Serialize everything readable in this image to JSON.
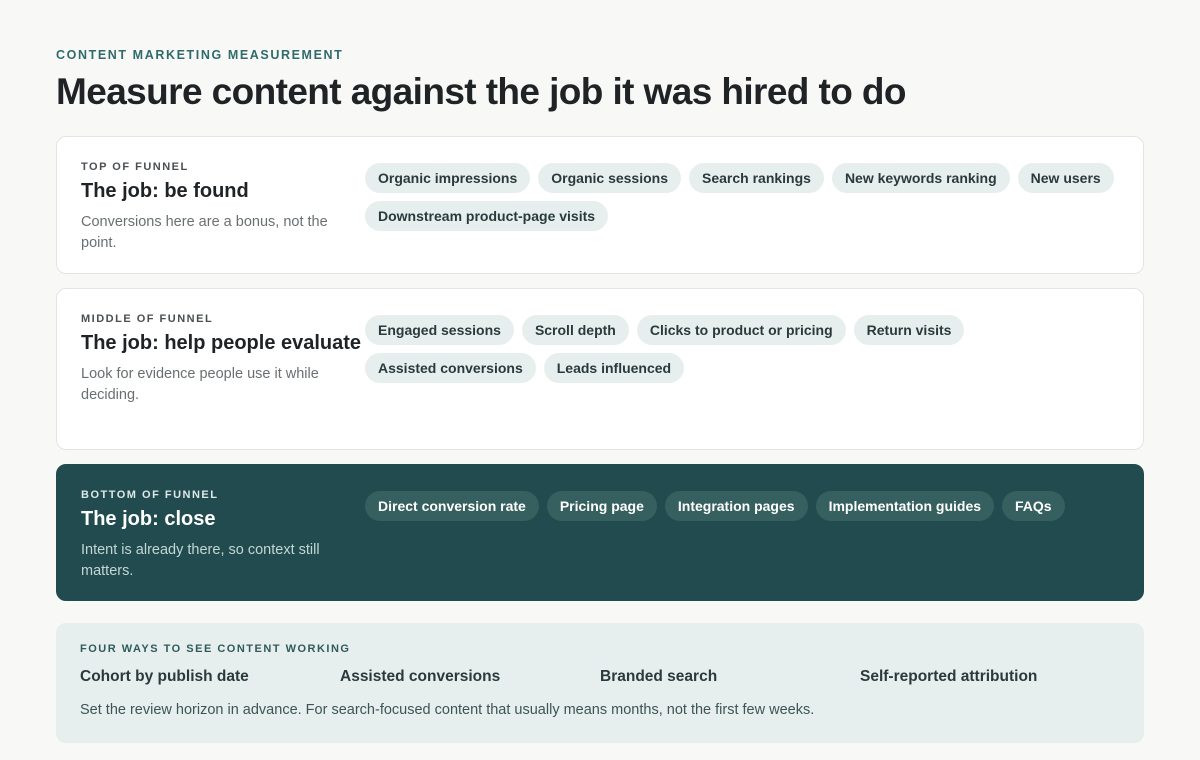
{
  "header": {
    "eyebrow": "CONTENT MARKETING MEASUREMENT",
    "title": "Measure content against the job it was hired to do"
  },
  "stages": [
    {
      "kicker": "TOP OF FUNNEL",
      "title": "The job: be found",
      "description": "Conversions here are a bonus, not the point.",
      "metrics": [
        "Organic impressions",
        "Organic sessions",
        "Search rankings",
        "New keywords ranking",
        "New users",
        "Downstream product-page visits"
      ]
    },
    {
      "kicker": "MIDDLE OF FUNNEL",
      "title": "The job: help people evaluate",
      "description": "Look for evidence people use it while deciding.",
      "metrics": [
        "Engaged sessions",
        "Scroll depth",
        "Clicks to product or pricing",
        "Return visits",
        "Assisted conversions",
        "Leads influenced"
      ]
    },
    {
      "kicker": "BOTTOM OF FUNNEL",
      "title": "The job: close",
      "description": "Intent is already there, so context still matters.",
      "metrics": [
        "Direct conversion rate",
        "Pricing page",
        "Integration pages",
        "Implementation guides",
        "FAQs"
      ]
    }
  ],
  "ways": {
    "kicker": "FOUR WAYS TO SEE CONTENT WORKING",
    "items": [
      "Cohort by publish date",
      "Assisted conversions",
      "Branded search",
      "Self-reported attribution"
    ],
    "note": "Set the review horizon in advance. For search-focused content that usually means months, not the first few weeks."
  },
  "colors": {
    "accent": "#2f6b6b",
    "dark_card": "#214b4e",
    "chip_light": "#e6efed",
    "page_bg": "#f8f8f7"
  }
}
